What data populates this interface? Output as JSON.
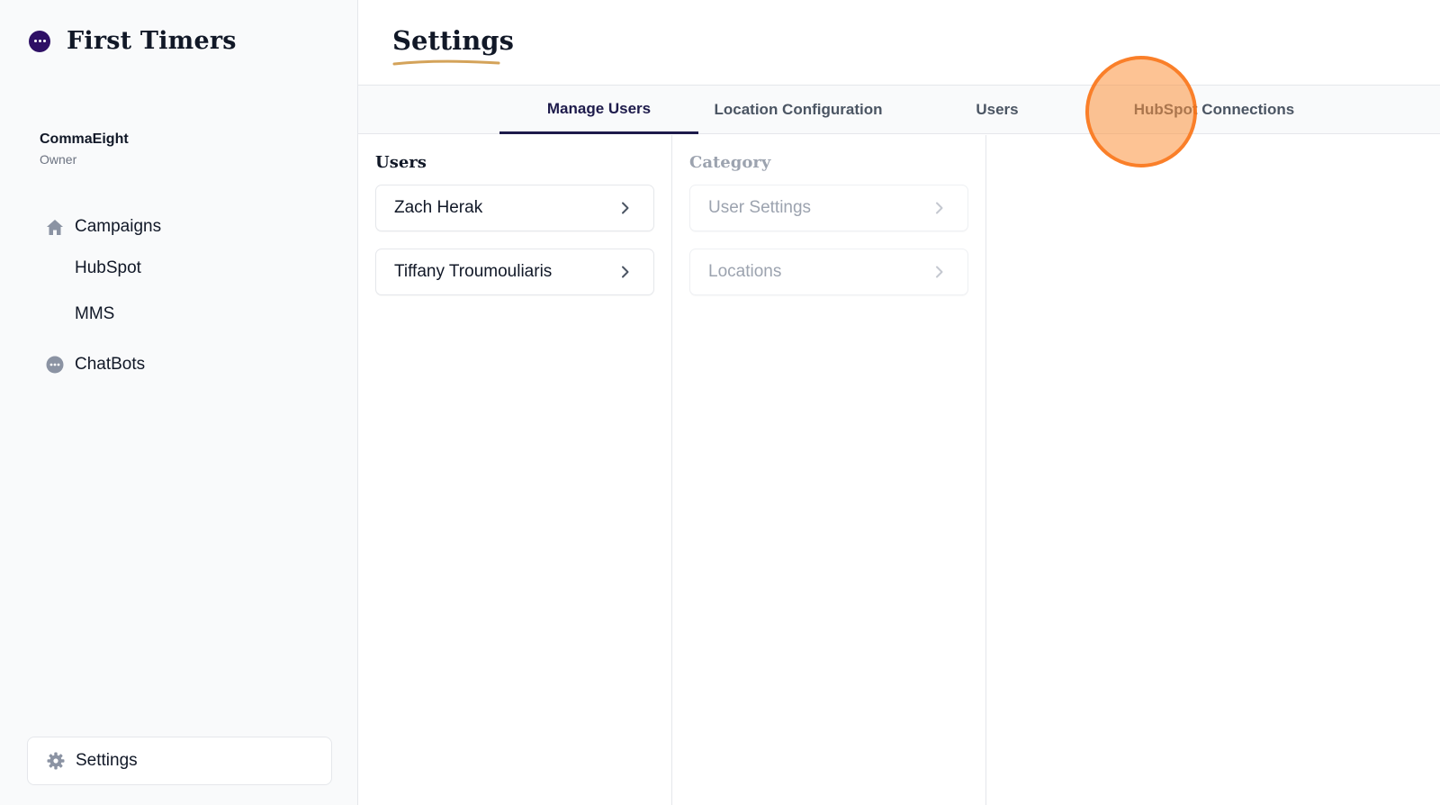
{
  "brand": {
    "name": "First Timers",
    "logo_icon": "chat-bubble-dots-icon",
    "logo_color": "#2e1065"
  },
  "account": {
    "name": "CommaEight",
    "role": "Owner"
  },
  "sidebar": {
    "items": [
      {
        "label": "Campaigns",
        "icon": "home-icon"
      },
      {
        "label": "HubSpot"
      },
      {
        "label": "MMS"
      },
      {
        "label": "ChatBots",
        "icon": "chat-dots-icon"
      }
    ],
    "settings_label": "Settings",
    "settings_icon": "gear-icon"
  },
  "header": {
    "title": "Settings",
    "underline_color": "#d4a35a"
  },
  "tabs": [
    {
      "label": "Manage Users",
      "active": true
    },
    {
      "label": "Location Configuration",
      "active": false
    },
    {
      "label": "Users",
      "active": false
    },
    {
      "label": "HubSpot Connections",
      "active": false
    }
  ],
  "users_column": {
    "heading": "Users",
    "items": [
      {
        "label": "Zach Herak"
      },
      {
        "label": "Tiffany Troumouliaris"
      }
    ]
  },
  "category_column": {
    "heading": "Category",
    "items": [
      {
        "label": "User Settings"
      },
      {
        "label": "Locations"
      }
    ]
  },
  "colors": {
    "accent": "#1e1b4b",
    "click_indicator": "#f97316"
  }
}
